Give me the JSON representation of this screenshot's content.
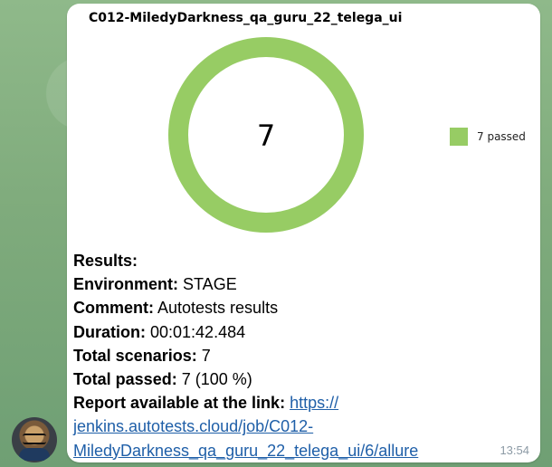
{
  "report": {
    "title": "C012-MiledyDarkness_qa_guru_22_telega_ui",
    "total_label": "7",
    "legend_label": "7 passed",
    "passed_color": "#97cc64"
  },
  "chart_data": {
    "type": "pie",
    "categories": [
      "passed"
    ],
    "values": [
      7
    ],
    "center_label": "7",
    "legend": [
      "7 passed"
    ],
    "legend_position": "right",
    "title": "C012-MiledyDarkness_qa_guru_22_telega_ui"
  },
  "message": {
    "results_label": "Results:",
    "environment_label": "Environment:",
    "environment_value": " STAGE",
    "comment_label": "Comment:",
    "comment_value": " Autotests results",
    "duration_label": "Duration:",
    "duration_value": " 00:01:42.484",
    "total_scenarios_label": "Total scenarios:",
    "total_scenarios_value": " 7",
    "total_passed_label": "Total passed:",
    "total_passed_value": " 7 (100 %)",
    "report_link_label": "Report available at the link:",
    "report_link_part1": "https://",
    "report_link_part2": "jenkins.autotests.cloud/job/C012-",
    "report_link_part3": "MiledyDarkness_qa_guru_22_telega_ui/6/allure",
    "timestamp": "13:54"
  },
  "avatar": {
    "icon": "cat-with-glasses-avatar"
  }
}
